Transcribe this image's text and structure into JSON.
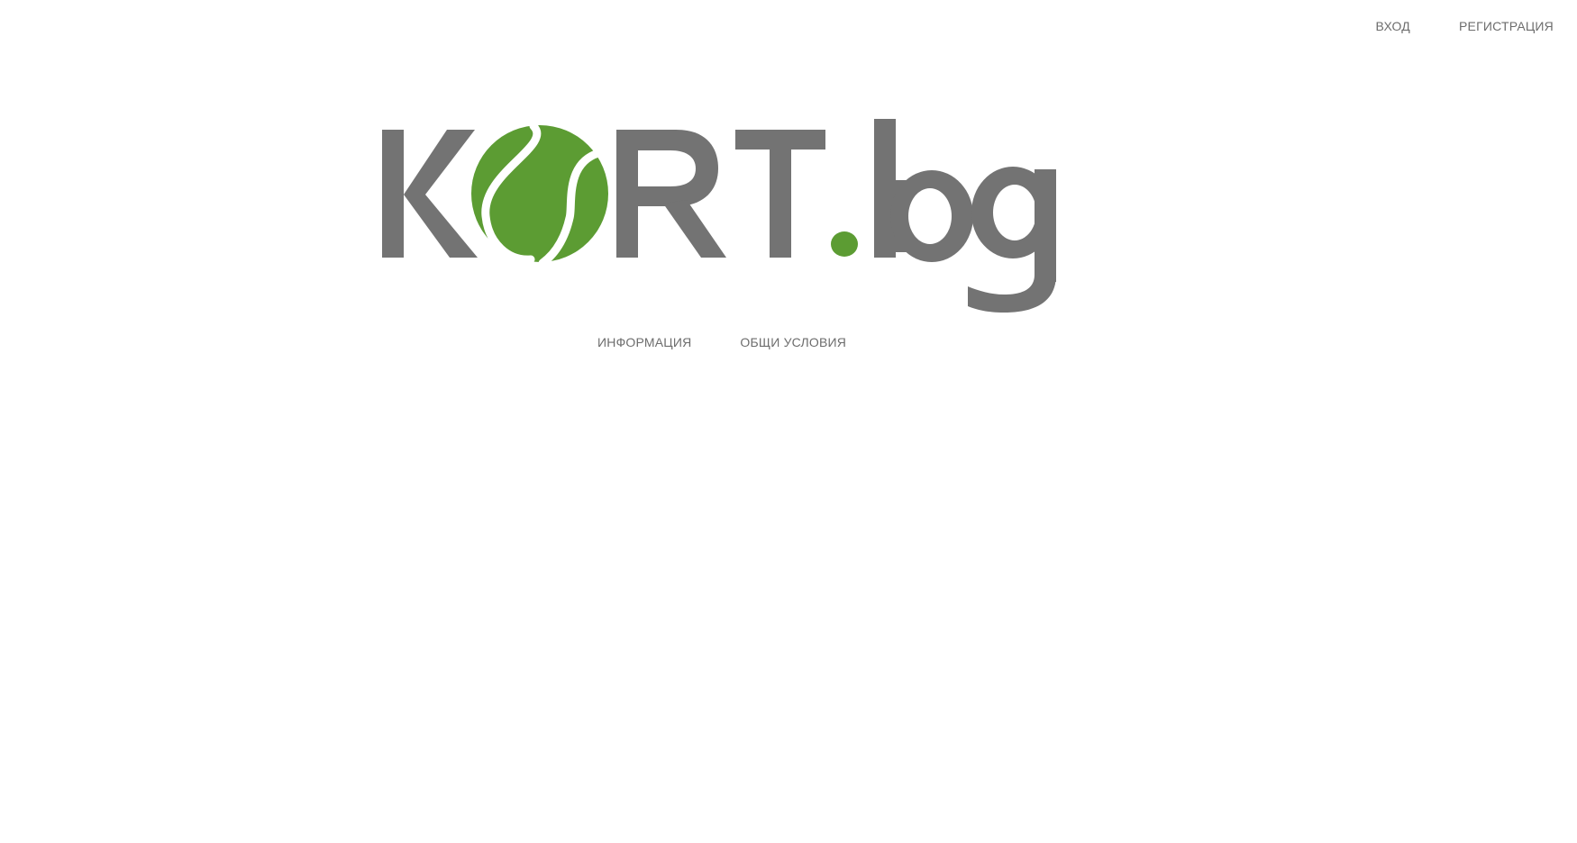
{
  "header": {
    "login_label": "ВХОД",
    "register_label": "РЕГИСТРАЦИЯ"
  },
  "logo": {
    "text": "KORT.bg",
    "colors": {
      "letters": "#737373",
      "ball": "#5c9c33",
      "seam": "#ffffff"
    }
  },
  "nav": {
    "info_label": "ИНФОРМАЦИЯ",
    "terms_label": "ОБЩИ УСЛОВИЯ"
  }
}
